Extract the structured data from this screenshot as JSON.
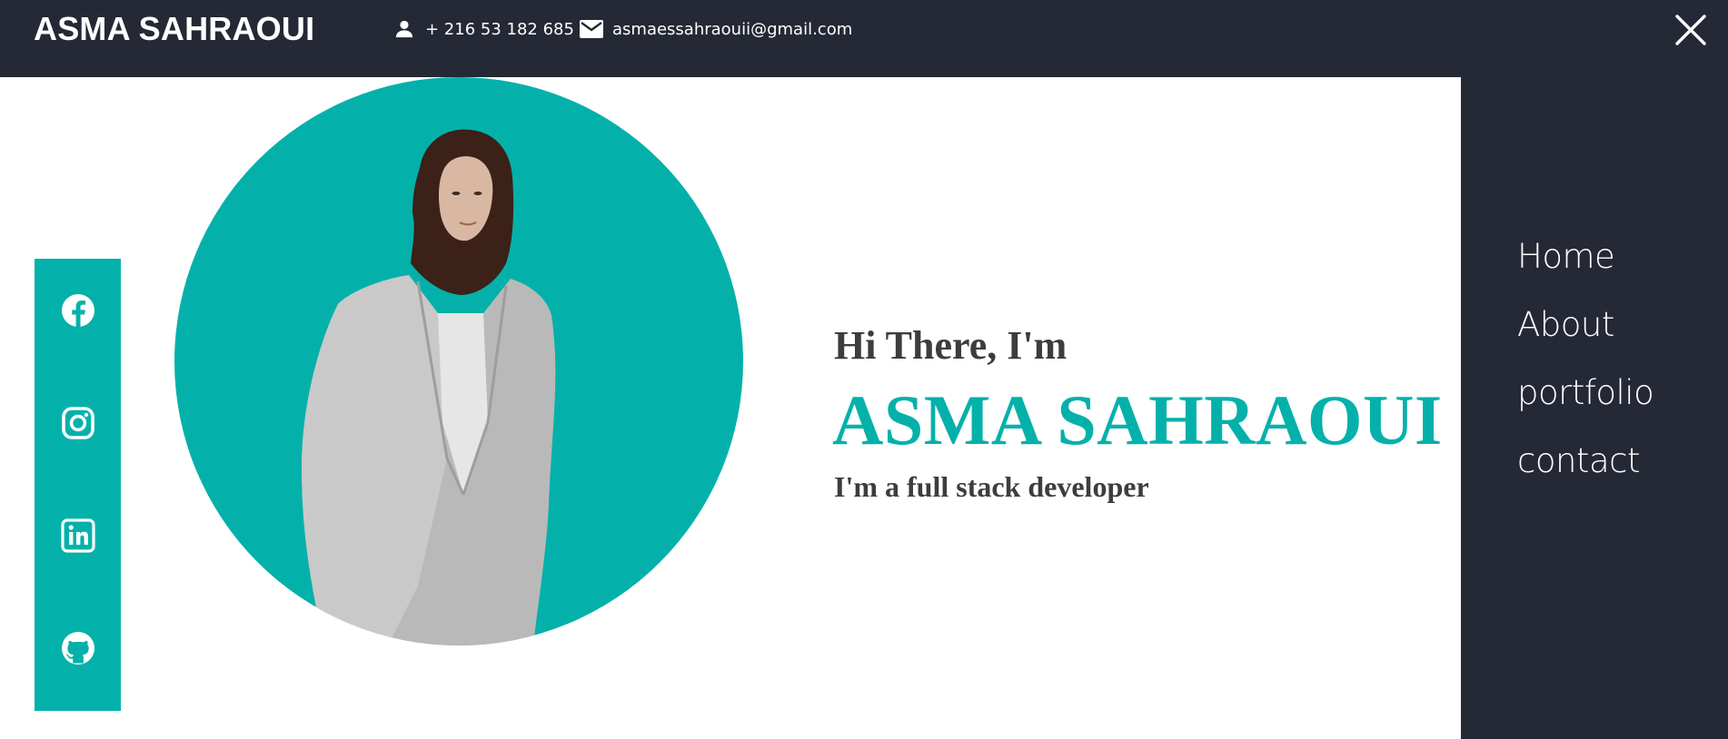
{
  "header": {
    "brand": "ASMA SAHRAOUI",
    "phone": "+ 216 53 182 685",
    "email": "asmaessahraouii@gmail.com",
    "phone_icon": "person-icon",
    "email_icon": "mail-icon",
    "close_icon": "close-icon"
  },
  "nav": {
    "items": [
      {
        "label": "Home"
      },
      {
        "label": "About"
      },
      {
        "label": "portfolio"
      },
      {
        "label": "contact"
      }
    ]
  },
  "social": {
    "icons": [
      "facebook-icon",
      "instagram-icon",
      "linkedin-icon",
      "github-icon"
    ]
  },
  "hero": {
    "greeting": "Hi There, I'm",
    "name": "ASMA SAHRAOUI",
    "role": "I'm a full stack developer"
  },
  "colors": {
    "accent": "#04b1aa",
    "dark": "#252935",
    "text": "#3d3d3d",
    "white": "#ffffff"
  }
}
